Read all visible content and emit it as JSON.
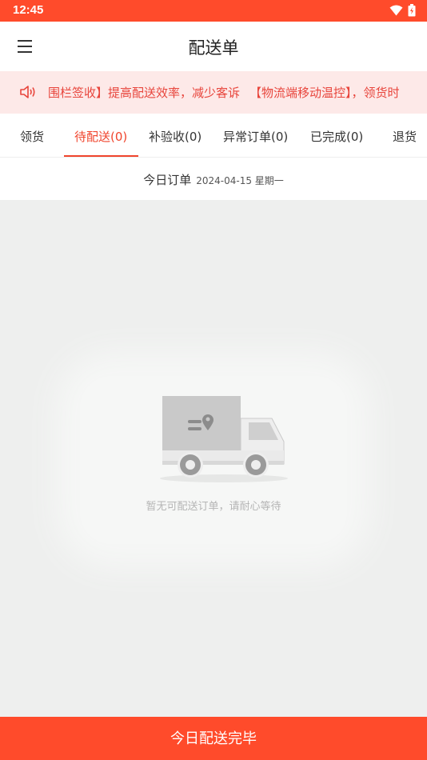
{
  "status_bar": {
    "time": "12:45"
  },
  "header": {
    "title": "配送单"
  },
  "notice": {
    "items": [
      "围栏签收】提高配送效率，减少客诉",
      "【物流端移动温控】，领货时"
    ]
  },
  "tabs": [
    {
      "label": "领货"
    },
    {
      "label": "待配送(0)"
    },
    {
      "label": "补验收(0)"
    },
    {
      "label": "异常订单(0)"
    },
    {
      "label": "已完成(0)"
    },
    {
      "label": "退货"
    }
  ],
  "date_row": {
    "title": "今日订单",
    "date": "2024-04-15 星期一"
  },
  "empty_state": {
    "message": "暂无可配送订单，请耐心等待",
    "icon": "delivery-truck-icon"
  },
  "footer": {
    "button_label": "今日配送完毕"
  },
  "colors": {
    "accent": "#ff4b2b",
    "notice_bg": "#fde9e8",
    "notice_text": "#e8453c"
  }
}
